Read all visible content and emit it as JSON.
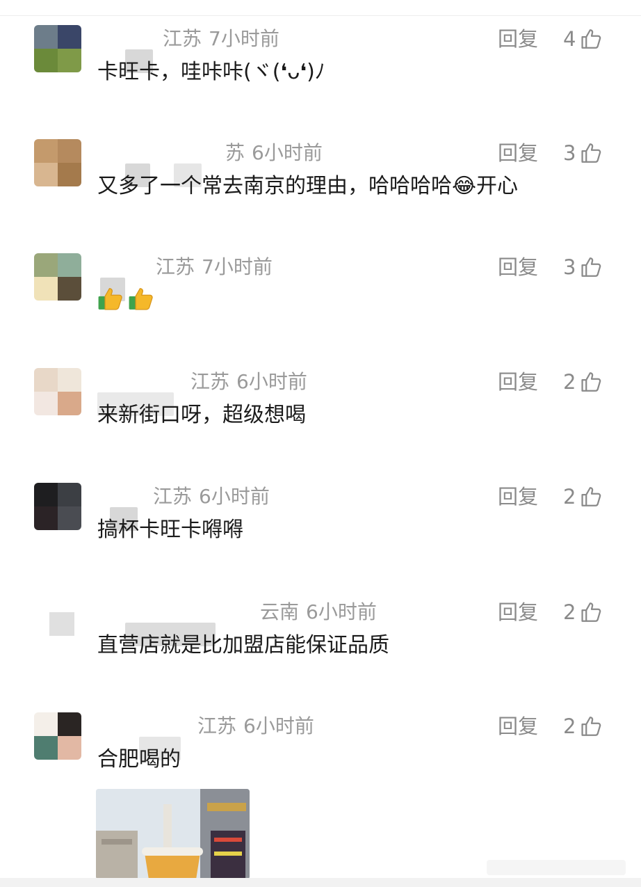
{
  "ui": {
    "reply_label": "回复"
  },
  "comments": [
    {
      "region": "江苏",
      "time": "7小时前",
      "likes": "4",
      "text": "卡旺卡，哇咔咔(ヾ(❛ᴗ❛)ﾉ"
    },
    {
      "region": "苏",
      "time": "6小时前",
      "likes": "3",
      "text": "又多了一个常去南京的理由，哈哈哈哈😂开心"
    },
    {
      "region": "江苏",
      "time": "7小时前",
      "likes": "3",
      "text": ""
    },
    {
      "region": "江苏",
      "time": "6小时前",
      "likes": "2",
      "text": "来新街口呀，超级想喝"
    },
    {
      "region": "江苏",
      "time": "6小时前",
      "likes": "2",
      "text": "搞杯卡旺卡嘚嘚"
    },
    {
      "region": "云南",
      "time": "6小时前",
      "likes": "2",
      "text": "直营店就是比加盟店能保证品质"
    },
    {
      "region": "江苏",
      "time": "6小时前",
      "likes": "2",
      "text": "合肥喝的"
    }
  ],
  "icons": {
    "like": "thumbs-up-outline-icon",
    "emoji": "thumbs-up-emoji-icon"
  },
  "colors": {
    "meta": "#9a9a9a",
    "text": "#1a1a1a",
    "emoji_yellow": "#f5b82a",
    "emoji_sleeve": "#3fa34d"
  }
}
